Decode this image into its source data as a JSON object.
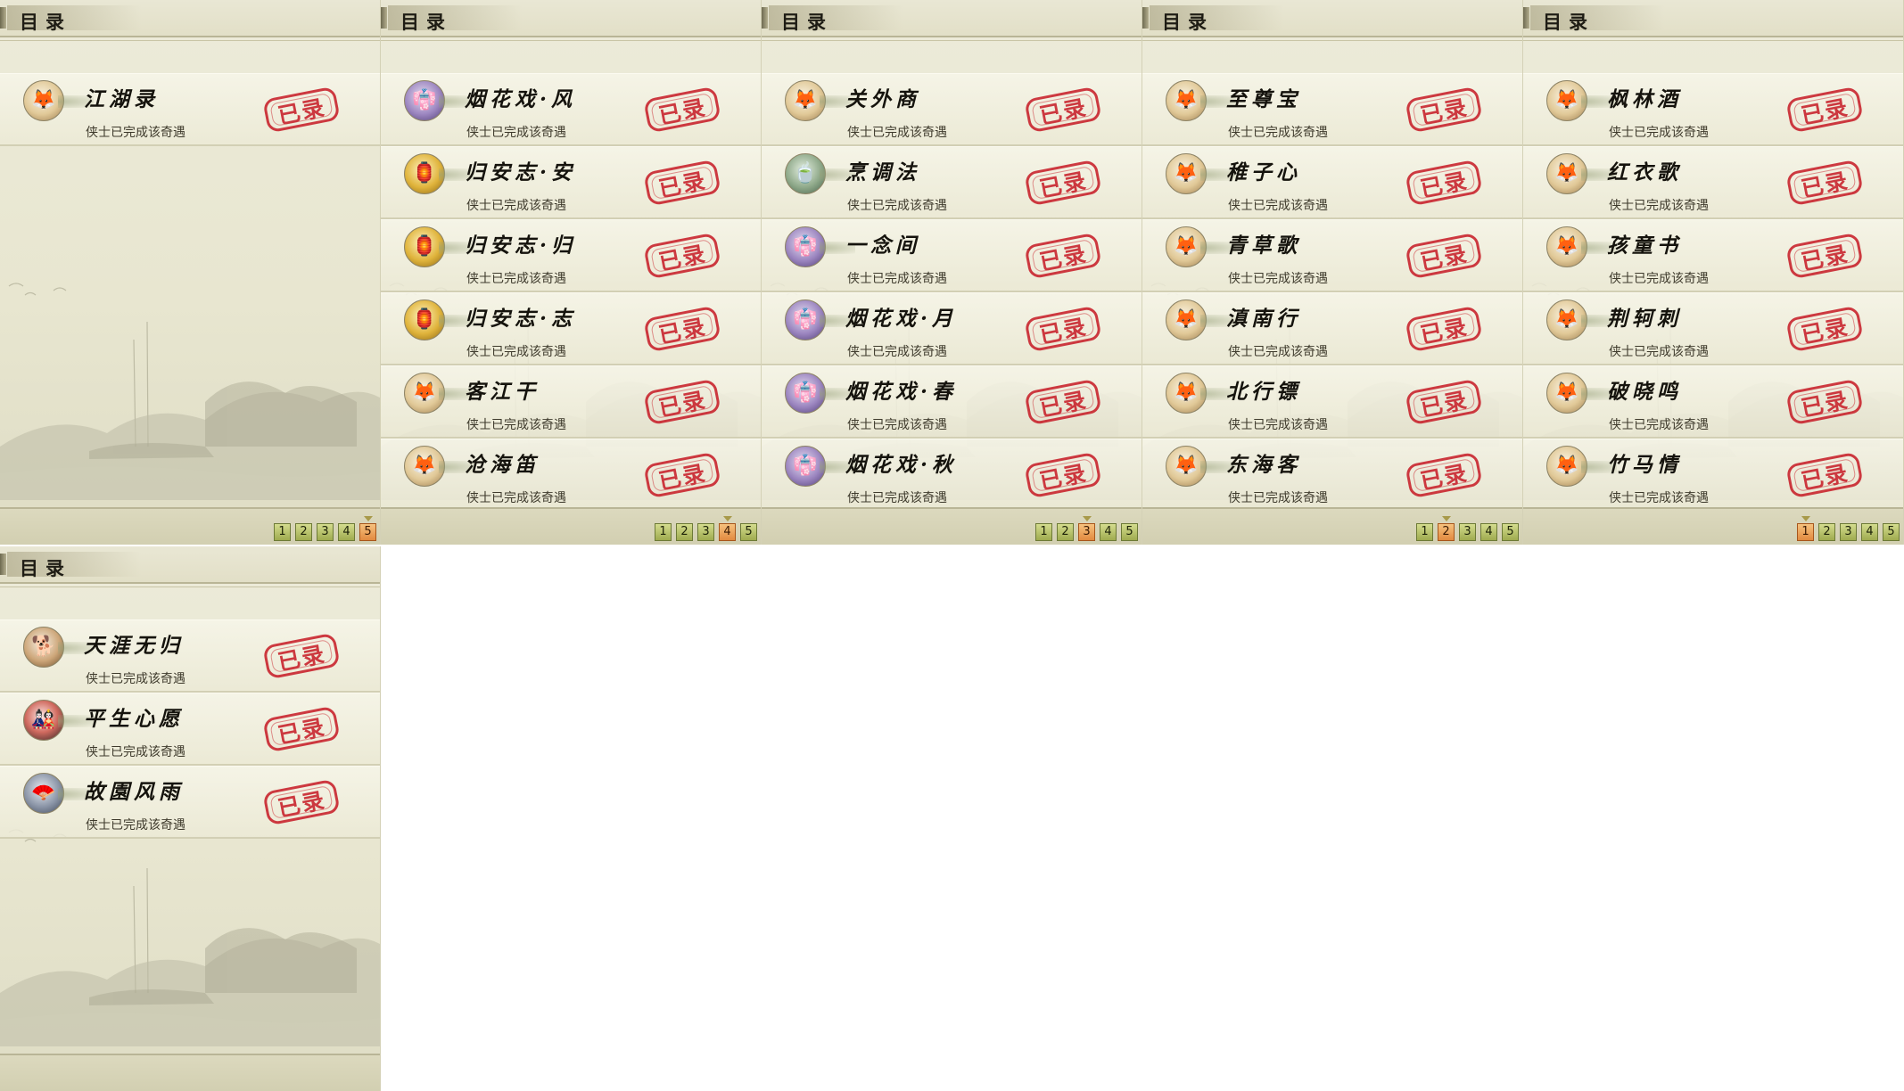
{
  "header_title": "目录",
  "stamp_text": "已录",
  "desc_text": "侠士已完成该奇遇",
  "pages": [
    "1",
    "2",
    "3",
    "4",
    "5"
  ],
  "panels": [
    {
      "active_page": 5,
      "items": [
        {
          "title": "江湖录",
          "icon": "fox-icon"
        }
      ]
    },
    {
      "active_page": 4,
      "items": [
        {
          "title": "烟花戏·风",
          "icon": "girl-icon"
        },
        {
          "title": "归安志·安",
          "icon": "gold-figure-icon"
        },
        {
          "title": "归安志·归",
          "icon": "gold-figure-icon"
        },
        {
          "title": "归安志·志",
          "icon": "gold-figure-icon"
        },
        {
          "title": "客江干",
          "icon": "fox-icon"
        },
        {
          "title": "沧海笛",
          "icon": "fox-icon"
        }
      ]
    },
    {
      "active_page": 3,
      "items": [
        {
          "title": "关外商",
          "icon": "fox-icon"
        },
        {
          "title": "烹调法",
          "icon": "jade-icon"
        },
        {
          "title": "一念间",
          "icon": "girl-icon"
        },
        {
          "title": "烟花戏·月",
          "icon": "girl-icon"
        },
        {
          "title": "烟花戏·春",
          "icon": "girl-icon"
        },
        {
          "title": "烟花戏·秋",
          "icon": "girl-icon"
        }
      ]
    },
    {
      "active_page": 2,
      "items": [
        {
          "title": "至尊宝",
          "icon": "fox-icon"
        },
        {
          "title": "稚子心",
          "icon": "fox-icon"
        },
        {
          "title": "青草歌",
          "icon": "fox-icon"
        },
        {
          "title": "滇南行",
          "icon": "fox-icon"
        },
        {
          "title": "北行镖",
          "icon": "fox-icon"
        },
        {
          "title": "东海客",
          "icon": "fox-icon"
        }
      ]
    },
    {
      "active_page": 1,
      "items": [
        {
          "title": "枫林酒",
          "icon": "fox-icon"
        },
        {
          "title": "红衣歌",
          "icon": "fox-icon"
        },
        {
          "title": "孩童书",
          "icon": "fox-icon"
        },
        {
          "title": "荆轲刺",
          "icon": "fox-icon"
        },
        {
          "title": "破晓鸣",
          "icon": "fox-icon"
        },
        {
          "title": "竹马情",
          "icon": "fox-icon"
        }
      ]
    },
    {
      "active_page": null,
      "items": [
        {
          "title": "天涯无归",
          "icon": "dog-icon"
        },
        {
          "title": "平生心愿",
          "icon": "doll-icon"
        },
        {
          "title": "故園风雨",
          "icon": "fan-icon"
        }
      ]
    }
  ]
}
